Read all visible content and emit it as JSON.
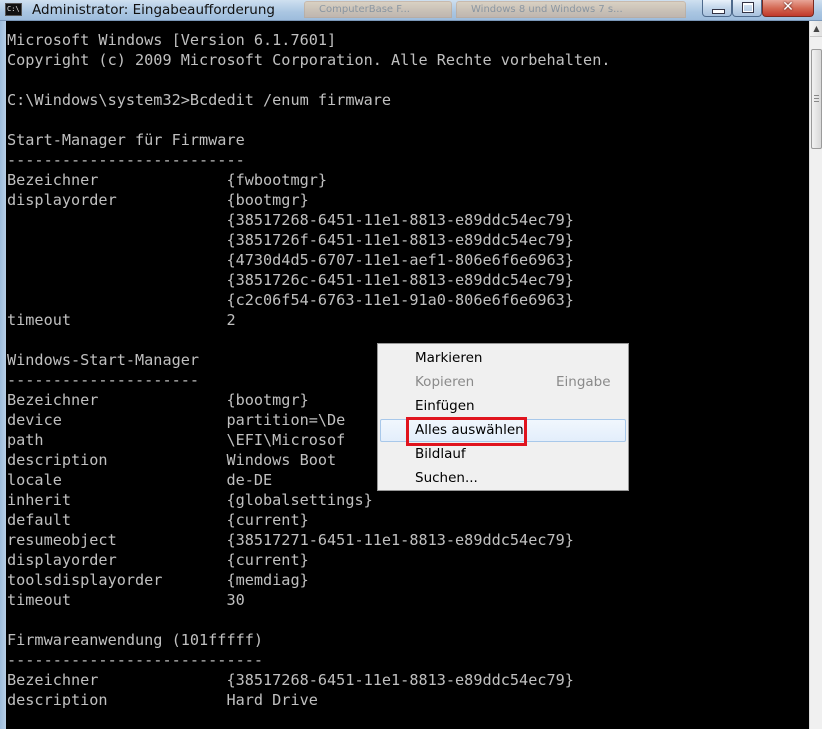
{
  "window": {
    "title": "Administrator: Eingabeaufforderung",
    "background_tabs": [
      "ComputerBase F...",
      "Windows 8 und Windows 7 s..."
    ],
    "icon": "cmd-icon",
    "close_symbol": "✕"
  },
  "console": {
    "lines": [
      "Microsoft Windows [Version 6.1.7601]",
      "Copyright (c) 2009 Microsoft Corporation. Alle Rechte vorbehalten.",
      "",
      "C:\\Windows\\system32>Bcdedit /enum firmware",
      "",
      "Start-Manager für Firmware",
      "--------------------------",
      "Bezeichner              {fwbootmgr}",
      "displayorder            {bootmgr}",
      "                        {38517268-6451-11e1-8813-e89ddc54ec79}",
      "                        {3851726f-6451-11e1-8813-e89ddc54ec79}",
      "                        {4730d4d5-6707-11e1-aef1-806e6f6e6963}",
      "                        {3851726c-6451-11e1-8813-e89ddc54ec79}",
      "                        {c2c06f54-6763-11e1-91a0-806e6f6e6963}",
      "timeout                 2",
      "",
      "Windows-Start-Manager",
      "---------------------",
      "Bezeichner              {bootmgr}",
      "device                  partition=\\De",
      "path                    \\EFI\\Microsof",
      "description             Windows Boot",
      "locale                  de-DE",
      "inherit                 {globalsettings}",
      "default                 {current}",
      "resumeobject            {38517271-6451-11e1-8813-e89ddc54ec79}",
      "displayorder            {current}",
      "toolsdisplayorder       {memdiag}",
      "timeout                 30",
      "",
      "Firmwareanwendung (101fffff)",
      "----------------------------",
      "Bezeichner              {38517268-6451-11e1-8813-e89ddc54ec79}",
      "description             Hard Drive"
    ]
  },
  "context_menu": {
    "items": [
      {
        "label": "Markieren",
        "shortcut": "",
        "enabled": true
      },
      {
        "label": "Kopieren",
        "shortcut": "Eingabe",
        "enabled": false
      },
      {
        "label": "Einfügen",
        "shortcut": "",
        "enabled": true
      },
      {
        "label": "Alles auswählen",
        "shortcut": "",
        "enabled": true,
        "hovered": true,
        "highlighted": true
      },
      {
        "label": "Bildlauf",
        "shortcut": "",
        "enabled": true
      },
      {
        "label": "Suchen...",
        "shortcut": "",
        "enabled": true
      }
    ]
  },
  "colors": {
    "console_bg": "#000000",
    "console_fg": "#c0c0c0",
    "highlight": "#e0141e"
  }
}
